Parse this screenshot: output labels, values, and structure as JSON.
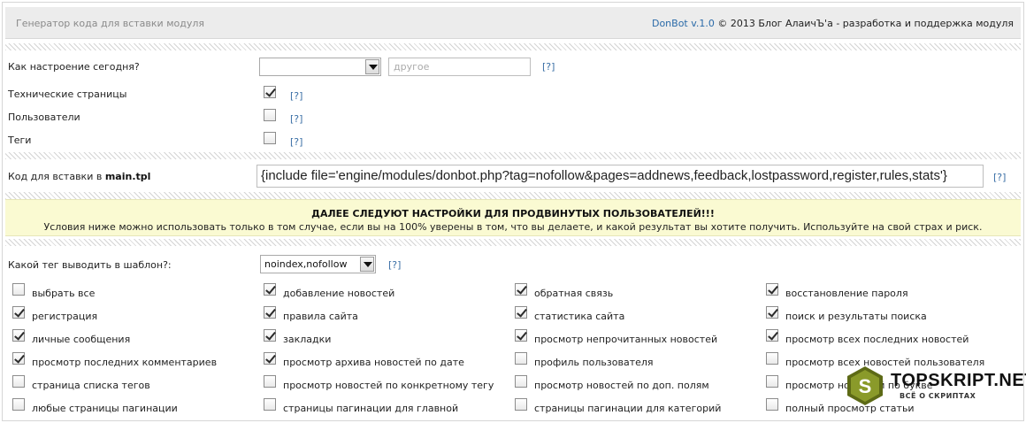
{
  "header": {
    "title": "Генератор кода для вставки модуля",
    "brand": "DonBot v.1.0",
    "credit": " © 2013 Блог АлаичЪ'а - разработка и поддержка модуля"
  },
  "settings": {
    "mood_label": "Как настроение сегодня?",
    "mood_selected": "",
    "mood_other_placeholder": "другое",
    "help_text": "[?]",
    "rows": [
      {
        "label": "Технические страницы",
        "checked": true
      },
      {
        "label": "Пользователи",
        "checked": false
      },
      {
        "label": "Теги",
        "checked": false
      }
    ]
  },
  "code": {
    "label_prefix": "Код для вставки в ",
    "label_file": "main.tpl",
    "value": "{include file='engine/modules/donbot.php?tag=nofollow&pages=addnews,feedback,lostpassword,register,rules,stats'}"
  },
  "warning": {
    "title": "ДАЛЕЕ СЛЕДУЮТ НАСТРОЙКИ ДЛЯ ПРОДВИНУТЫХ ПОЛЬЗОВАТЕЛЕЙ!!!",
    "text": "Условия ниже можно использовать только в том случае, если вы на 100% уверены в том, что вы делаете, и какой результат вы хотите получить. Используйте на свой страх и риск."
  },
  "advanced": {
    "tag_label": "Какой тег выводить в шаблон?:",
    "tag_selected": "noindex,nofollow",
    "options": [
      {
        "label": "выбрать все",
        "checked": false
      },
      {
        "label": "добавление новостей",
        "checked": true
      },
      {
        "label": "обратная связь",
        "checked": true
      },
      {
        "label": "восстановление пароля",
        "checked": true
      },
      {
        "label": "регистрация",
        "checked": true
      },
      {
        "label": "правила сайта",
        "checked": true
      },
      {
        "label": "статистика сайта",
        "checked": true
      },
      {
        "label": "поиск и результаты поиска",
        "checked": true
      },
      {
        "label": "личные сообщения",
        "checked": true
      },
      {
        "label": "закладки",
        "checked": true
      },
      {
        "label": "просмотр непрочитанных новостей",
        "checked": true
      },
      {
        "label": "просмотр всех последних новостей",
        "checked": true
      },
      {
        "label": "просмотр последних комментариев",
        "checked": true
      },
      {
        "label": "просмотр архива новостей по дате",
        "checked": true
      },
      {
        "label": "профиль пользователя",
        "checked": false
      },
      {
        "label": "просмотр всех новостей пользователя",
        "checked": false
      },
      {
        "label": "страница списка тегов",
        "checked": false
      },
      {
        "label": "просмотр новостей по конкретному тегу",
        "checked": false
      },
      {
        "label": "просмотр новостей по доп. полям",
        "checked": false
      },
      {
        "label": "просмотр новостей по букве",
        "checked": false
      },
      {
        "label": "любые страницы пагинации",
        "checked": false
      },
      {
        "label": "страницы пагинации для главной",
        "checked": false
      },
      {
        "label": "страницы пагинации для категорий",
        "checked": false
      },
      {
        "label": "полный просмотр статьи",
        "checked": false
      }
    ]
  },
  "watermark": {
    "letter": "S",
    "name": "TOPSKRIPT.NET",
    "tagline": "ВСЁ О СКРИПТАХ",
    "colors": {
      "hex": "#8a9a2a",
      "hex_dark": "#5d6a16"
    }
  }
}
